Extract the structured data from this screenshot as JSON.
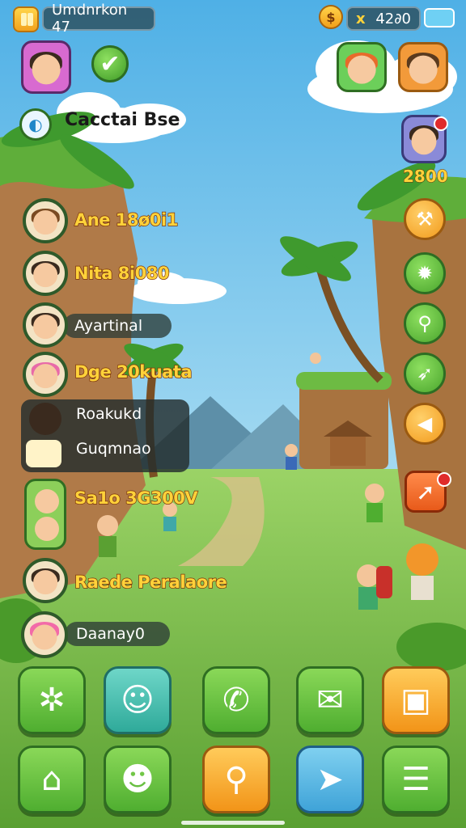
{
  "top_bar": {
    "player_title": "Umdnrkon 47",
    "currency_value": "42∂0",
    "currency_symbol": "x"
  },
  "status_label": "Cacctai Bse",
  "right_panel": {
    "score": "2800"
  },
  "friends": [
    {
      "name": "Ane 18ø0i1",
      "style": "gold",
      "hair": "#7a4a22",
      "skin": "#f6c9a0"
    },
    {
      "name": "Nita 8i080",
      "style": "gold",
      "hair": "#3a2a1e",
      "skin": "#f3c59a"
    },
    {
      "name": "Ayartinal",
      "style": "pill",
      "hair": "#3a2a1e",
      "skin": "#f6c9a0"
    },
    {
      "name": "Dge 20kuata",
      "style": "gold",
      "hair": "#e86aa8",
      "skin": "#f6cdb0"
    },
    {
      "name": "Sa1o 3G300V",
      "style": "gold",
      "hair": "#7a3a1e",
      "skin": "#f6c9a0"
    },
    {
      "name": "Raede Peralaore",
      "style": "gold",
      "hair": "#3a2a1e",
      "skin": "#f3c59a"
    },
    {
      "name": "Daanay0",
      "style": "pill",
      "hair": "#f26aa8",
      "skin": "#f6cdb0"
    }
  ],
  "group": {
    "line1": "Roakukd",
    "line2": "Guqmnao"
  },
  "dock": {
    "row1": [
      "target-icon",
      "storage-icon",
      "phone-icon",
      "chat-icon",
      "photo-icon"
    ],
    "row2": [
      "home-icon",
      "character-icon",
      "map-icon",
      "send-icon",
      "notes-icon"
    ]
  },
  "colors": {
    "sky_top": "#5bb6e8",
    "grass": "#7fc24a",
    "accent_gold": "#ffd23a",
    "button_green": "#5cb83a",
    "button_orange": "#f29a1c"
  }
}
